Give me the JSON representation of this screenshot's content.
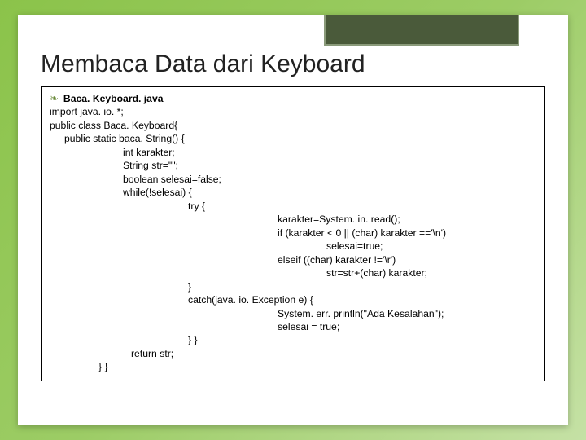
{
  "slide": {
    "title": "Membaca Data dari Keyboard",
    "filename": "Baca. Keyboard. java",
    "code": {
      "l1": "import java. io. *;",
      "l2": "public class Baca. Keyboard{",
      "l3": "public static baca. String() {",
      "l4": "int karakter;",
      "l5": "String str=\"\";",
      "l6": "boolean selesai=false;",
      "l7": "while(!selesai) {",
      "l8": "try {",
      "l9": "karakter=System. in. read();",
      "l10": "if (karakter < 0 || (char) karakter =='\\n')",
      "l11": "selesai=true;",
      "l12": "elseif ((char) karakter !='\\r')",
      "l13": "str=str+(char) karakter;",
      "l14": "}",
      "l15": "catch(java. io. Exception e) {",
      "l16": "System. err. println(\"Ada Kesalahan\");",
      "l17": "selesai = true;",
      "l18": "} }",
      "l19": "return str;",
      "l20": "} }"
    }
  }
}
